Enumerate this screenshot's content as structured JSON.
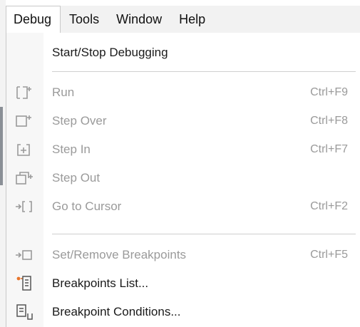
{
  "menubar": {
    "items": [
      {
        "label": "Debug",
        "active": true
      },
      {
        "label": "Tools",
        "active": false
      },
      {
        "label": "Window",
        "active": false
      },
      {
        "label": "Help",
        "active": false
      }
    ]
  },
  "debug_menu": {
    "items": [
      {
        "label": "Start/Stop Debugging",
        "shortcut": "",
        "enabled": true,
        "icon": ""
      },
      {
        "label": "Run",
        "shortcut": "Ctrl+F9",
        "enabled": false,
        "icon": "run-icon"
      },
      {
        "label": "Step Over",
        "shortcut": "Ctrl+F8",
        "enabled": false,
        "icon": "step-over-icon"
      },
      {
        "label": "Step In",
        "shortcut": "Ctrl+F7",
        "enabled": false,
        "icon": "step-in-icon"
      },
      {
        "label": "Step Out",
        "shortcut": "",
        "enabled": false,
        "icon": "step-out-icon"
      },
      {
        "label": "Go to Cursor",
        "shortcut": "Ctrl+F2",
        "enabled": false,
        "icon": "go-to-cursor-icon"
      },
      {
        "label": "Set/Remove Breakpoints",
        "shortcut": "Ctrl+F5",
        "enabled": false,
        "icon": "toggle-breakpoint-icon"
      },
      {
        "label": "Breakpoints List...",
        "shortcut": "",
        "enabled": true,
        "icon": "breakpoints-list-icon"
      },
      {
        "label": "Breakpoint Conditions...",
        "shortcut": "",
        "enabled": true,
        "icon": "breakpoint-conditions-icon"
      }
    ]
  },
  "colors": {
    "disabled_text": "#9a9a9a",
    "enabled_text": "#1a1a1a",
    "accent_orange": "#e8742a"
  }
}
